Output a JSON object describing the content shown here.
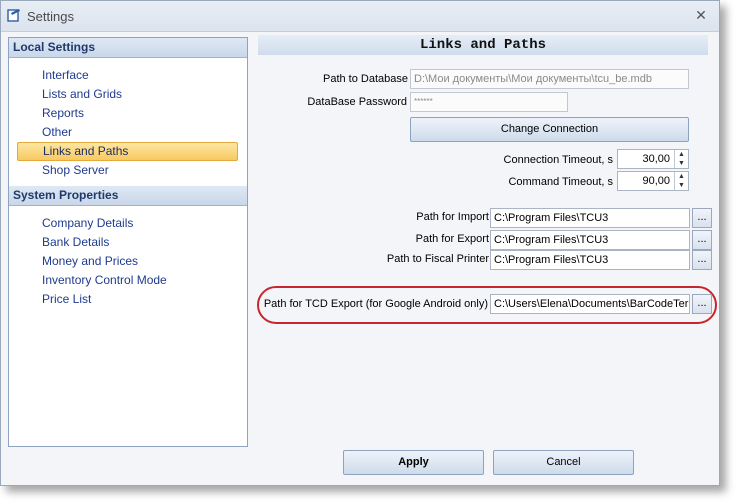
{
  "window": {
    "title": "Settings",
    "close_glyph": "✕"
  },
  "sidebar": {
    "groups": [
      {
        "header": "Local Settings",
        "items": [
          "Interface",
          "Lists and Grids",
          "Reports",
          "Other",
          "Links and Paths",
          "Shop Server"
        ]
      },
      {
        "header": "System Properties",
        "items": [
          "Company Details",
          "Bank Details",
          "Money and Prices",
          "Inventory Control Mode",
          "Price List"
        ]
      }
    ],
    "selected": "Links and Paths"
  },
  "main": {
    "header": "Links and Paths",
    "path_to_database": {
      "label": "Path to Database",
      "value": "D:\\Мои документы\\Мои документы\\tcu_be.mdb"
    },
    "database_password": {
      "label": "DataBase Password",
      "value": "******"
    },
    "change_connection_label": "Change Connection",
    "connection_timeout": {
      "label": "Connection Timeout, s",
      "value": "30,00"
    },
    "command_timeout": {
      "label": "Command Timeout, s",
      "value": "90,00"
    },
    "path_for_import": {
      "label": "Path for Import",
      "value": "C:\\Program Files\\TCU3"
    },
    "path_for_export": {
      "label": "Path for Export",
      "value": "C:\\Program Files\\TCU3"
    },
    "path_to_fiscal_printer": {
      "label": "Path to Fiscal Printer",
      "value": "C:\\Program Files\\TCU3"
    },
    "path_for_tcd_export": {
      "label": "Path for TCD Export (for Google Android only)",
      "value": "C:\\Users\\Elena\\Documents\\BarCodeTer"
    },
    "browse_label": "...",
    "spin_up": "▲",
    "spin_down": "▼"
  },
  "footer": {
    "apply_label": "Apply",
    "cancel_label": "Cancel"
  },
  "colors": {
    "highlight": "#c8262d",
    "selected_item": "#f7c960",
    "nav_text": "#1f3b8f"
  }
}
